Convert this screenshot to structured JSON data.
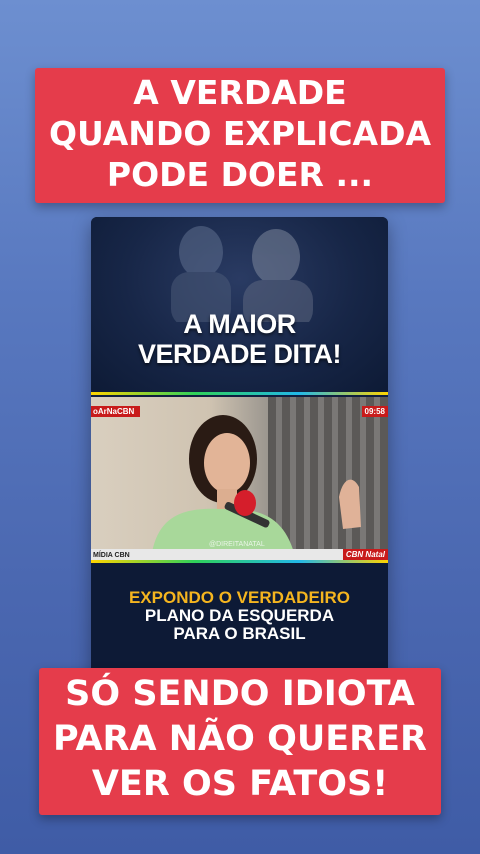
{
  "top_banner": {
    "lines": [
      "A VERDADE",
      "QUANDO EXPLICADA",
      "PODE DOER ..."
    ]
  },
  "card": {
    "headline": [
      "A MAIOR",
      "VERDADE DITA!"
    ],
    "video": {
      "tag_left": "oArNaCBN",
      "clock": "09:58",
      "lower_left": "MÍDIA CBN",
      "watermark": "@DIREITANATAL",
      "lower_right": "CBN Natal"
    },
    "caption": {
      "line1": "EXPONDO O VERDADEIRO",
      "line2": "PLANO DA ESQUERDA",
      "line3": "PARA O BRASIL"
    }
  },
  "bottom_banner": {
    "lines": [
      "SÓ SENDO IDIOTA",
      "PARA NÃO QUERER",
      "VER OS FATOS!"
    ]
  },
  "colors": {
    "banner_red": "#e53c4b",
    "caption_yellow": "#f5b51f",
    "card_navy": "#0f1e3f",
    "cbn_red": "#c81b1b"
  }
}
